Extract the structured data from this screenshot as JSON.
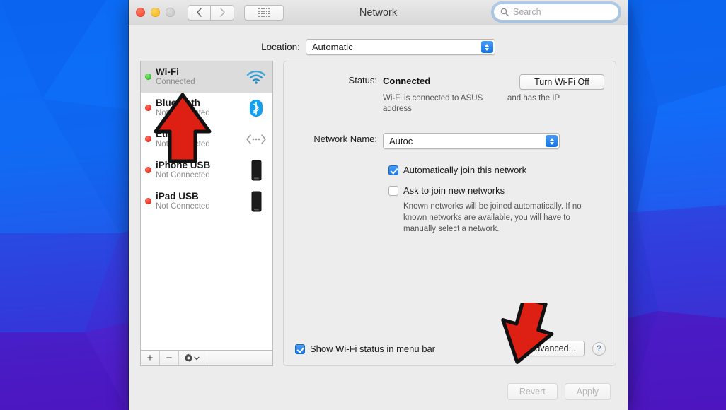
{
  "window": {
    "title": "Network",
    "traffic_lights": [
      "close",
      "minimize",
      "zoom"
    ],
    "nav_back": "back-chevron",
    "nav_forward": "forward-chevron",
    "show_all": "grid-icon"
  },
  "search": {
    "placeholder": "Search",
    "value": "",
    "icon": "search-icon"
  },
  "location": {
    "label": "Location:",
    "value": "Automatic"
  },
  "services": [
    {
      "name": "Wi-Fi",
      "status": "Connected",
      "dot": "green",
      "icon": "wifi-icon",
      "selected": true
    },
    {
      "name": "Bluetooth",
      "status": "Not Connected",
      "dot": "red",
      "icon": "bluetooth-icon",
      "selected": false
    },
    {
      "name": "Ethernet",
      "status": "Not Connected",
      "dot": "red",
      "icon": "ethernet-icon",
      "selected": false
    },
    {
      "name": "iPhone USB",
      "status": "Not Connected",
      "dot": "red",
      "icon": "iphone-icon",
      "selected": false
    },
    {
      "name": "iPad USB",
      "status": "Not Connected",
      "dot": "red",
      "icon": "ipad-icon",
      "selected": false
    }
  ],
  "service_toolbar": {
    "add": "+",
    "remove": "−",
    "actions": "gear-icon"
  },
  "status": {
    "label": "Status:",
    "value": "Connected",
    "turn_off_button": "Turn Wi-Fi Off",
    "description_left": "Wi-Fi is connected to ASUS",
    "description_right": "and has the IP",
    "description_tail": "address"
  },
  "network_name": {
    "label": "Network Name:",
    "value": "Autoc"
  },
  "options": {
    "auto_join": {
      "label": "Automatically join this network",
      "checked": true
    },
    "ask_to_join": {
      "label": "Ask to join new networks",
      "checked": false
    },
    "hint": "Known networks will be joined automatically. If no known networks are available, you will have to manually select a network.",
    "show_status_menubar": {
      "label": "Show Wi-Fi status in menu bar",
      "checked": true
    }
  },
  "actions": {
    "advanced": "Advanced...",
    "help": "?",
    "revert": "Revert",
    "apply": "Apply"
  },
  "annotations": [
    {
      "name": "arrow-pointing-wifi",
      "direction": "up",
      "color": "#e01b10"
    },
    {
      "name": "arrow-pointing-advanced",
      "direction": "down",
      "color": "#e01b10"
    }
  ],
  "colors": {
    "accent": "#1a7aee",
    "annotation": "#e01b10",
    "connected": "#16b81e",
    "disconnected": "#e01b10"
  }
}
